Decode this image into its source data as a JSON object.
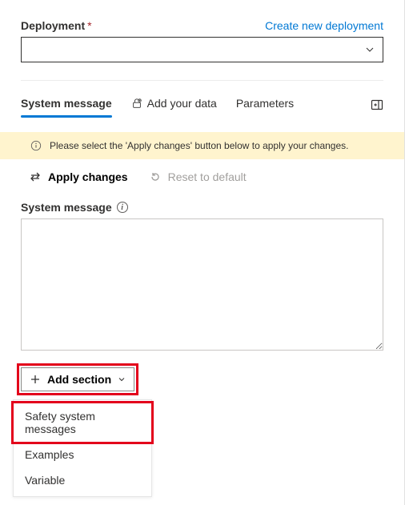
{
  "deployment": {
    "label": "Deployment",
    "required_marker": "*",
    "create_link": "Create new deployment",
    "selected": ""
  },
  "tabs": {
    "system_message": "System message",
    "add_your_data": "Add your data",
    "parameters": "Parameters"
  },
  "notice": {
    "text": "Please select the 'Apply changes' button below to apply your changes."
  },
  "actions": {
    "apply": "Apply changes",
    "reset": "Reset to default"
  },
  "system_message": {
    "label": "System message",
    "value": ""
  },
  "add_section": {
    "button": "Add section",
    "menu": {
      "safety": "Safety system messages",
      "examples": "Examples",
      "variable": "Variable"
    }
  }
}
